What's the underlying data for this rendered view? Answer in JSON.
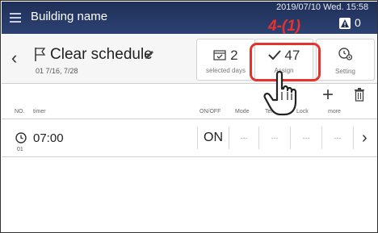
{
  "topbar": {
    "building_name": "Building name",
    "datetime": "2019/07/10 Wed. 15:58",
    "alert_count": "0"
  },
  "schedule": {
    "title": "Clear schedule",
    "subtitle": "01  7/16, 7/28"
  },
  "tiles": [
    {
      "value": "2",
      "label": "selected days"
    },
    {
      "value": "47",
      "label": "Assign"
    },
    {
      "value": "",
      "label": "Setting"
    }
  ],
  "annotation": {
    "label": "4-(1)",
    "color": "#e6322f"
  },
  "toolbar": {
    "add": "+"
  },
  "columns": {
    "no": "NO.",
    "timer": "timer",
    "onoff": "ON/OFF",
    "mode": "Mode",
    "temp": "Temp",
    "lock": "Lock",
    "more": "more"
  },
  "rows": [
    {
      "num": "01",
      "time": "07:00",
      "onoff": "ON",
      "mode": "---",
      "temp": "---",
      "lock": "---",
      "more": "---"
    }
  ],
  "colors": {
    "topbar": "#1f2f57",
    "accent": "#e6322f"
  }
}
